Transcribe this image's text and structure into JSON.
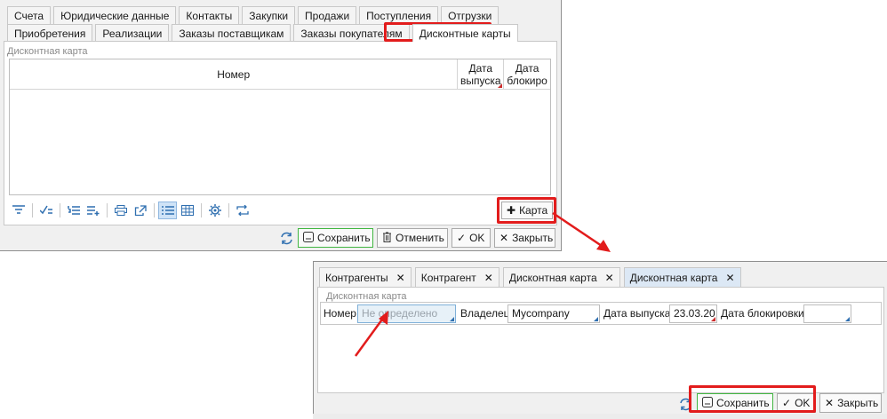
{
  "window1": {
    "tabs_row1": [
      "Счета",
      "Юридические данные",
      "Контакты",
      "Закупки",
      "Продажи",
      "Поступления",
      "Отгрузки"
    ],
    "tabs_row2": [
      "Приобретения",
      "Реализации",
      "Заказы поставщикам",
      "Заказы покупателям",
      "Дисконтные карты"
    ],
    "group_label": "Дисконтная карта",
    "columns": {
      "number": "Номер",
      "issue_date": "Дата выпуска",
      "block_date": "Дата блокиро"
    },
    "add_card_button": "Карта",
    "buttons": {
      "save": "Сохранить",
      "cancel": "Отменить",
      "ok": "OK",
      "close": "Закрыть"
    }
  },
  "window2": {
    "tabs": [
      "Контрагенты",
      "Контрагент",
      "Дисконтная карта",
      "Дисконтная карта"
    ],
    "group_label": "Дисконтная карта",
    "fields": {
      "number_label": "Номер",
      "number_placeholder": "Не определено",
      "owner_label": "Владелец",
      "owner_value": "Mycompany",
      "issue_label": "Дата выпуска",
      "issue_value": "23.03.20",
      "block_label": "Дата блокировки",
      "block_value": ""
    },
    "buttons": {
      "save": "Сохранить",
      "ok": "OK",
      "close": "Закрыть"
    }
  },
  "colors": {
    "highlight": "#e21c1c",
    "accent": "#2f6fb0",
    "save_border": "#41b641"
  }
}
